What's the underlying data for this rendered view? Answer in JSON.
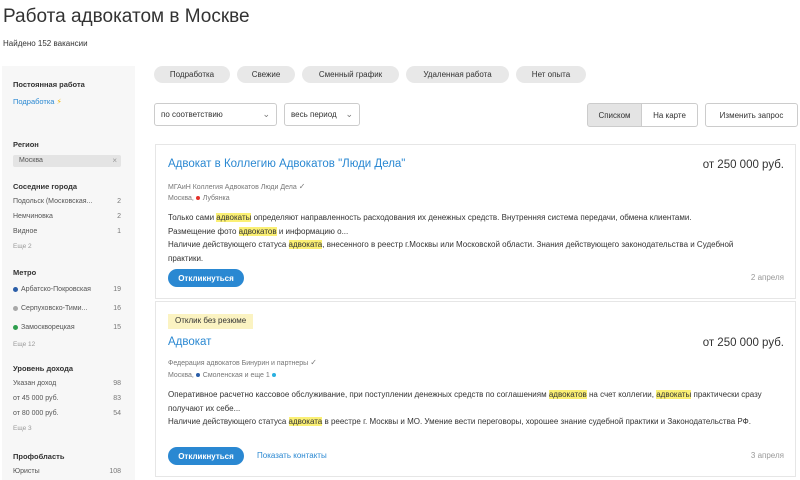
{
  "header": {
    "title": "Работа адвокатом в Москве",
    "found": "Найдено 152 вакансии"
  },
  "sidebar": {
    "permanent": {
      "heading": "Постоянная работа",
      "link": "Подработка"
    },
    "region": {
      "heading": "Регион",
      "value": "Москва",
      "clear": "×"
    },
    "nearby": {
      "heading": "Соседние города",
      "items": [
        {
          "label": "Подольск (Московская...",
          "count": "2"
        },
        {
          "label": "Немчиновка",
          "count": "2"
        },
        {
          "label": "Видное",
          "count": "1"
        }
      ],
      "more": "Еще 2"
    },
    "metro": {
      "heading": "Метро",
      "items": [
        {
          "label": "Арбатско-Покровская",
          "count": "19",
          "color": "#2b5ea8"
        },
        {
          "label": "Серпуховско-Тими...",
          "count": "16",
          "color": "#a8a8a8"
        },
        {
          "label": "Замоскворецкая",
          "count": "15",
          "color": "#2e9e4d"
        }
      ],
      "more": "Еще 12"
    },
    "income": {
      "heading": "Уровень дохода",
      "items": [
        {
          "label": "Указан доход",
          "count": "98"
        },
        {
          "label": "от 45 000 руб.",
          "count": "83"
        },
        {
          "label": "от 80 000 руб.",
          "count": "54"
        }
      ],
      "more": "Еще 3"
    },
    "profarea": {
      "heading": "Профобласть",
      "items": [
        {
          "label": "Юристы",
          "count": "108"
        }
      ]
    }
  },
  "filters": {
    "pills": [
      "Подработка",
      "Свежие",
      "Сменный график",
      "Удаленная работа",
      "Нет опыта"
    ]
  },
  "controls": {
    "sort": "по соответствию",
    "period": "весь период",
    "view_list": "Списком",
    "view_map": "На карте",
    "change_query": "Изменить запрос"
  },
  "vacancies": [
    {
      "title": "Адвокат в Коллегию Адвокатов \"Люди Дела\"",
      "salary": "от 250 000 руб.",
      "company": "МГАиН Коллегия Адвокатов Люди Дела",
      "location_city": "Москва,",
      "location_metro": "Лубянка",
      "metro_color": "#e4312b",
      "desc": [
        [
          "Только сами ",
          "адвокаты",
          " определяют направленность расходования их денежных средств. Внутренняя система передачи, обмена клиентами."
        ],
        [
          "Размещение фото ",
          "адвокатов",
          " и информацию о..."
        ],
        [
          "Наличие действующего статуса ",
          "адвоката",
          ", внесенного в реестр г.Москвы или Московской области. Знания действующего законодательства и Судебной практики."
        ]
      ],
      "respond": "Откликнуться",
      "date": "2 апреля"
    },
    {
      "badge": "Отклик без резюме",
      "title": "Адвокат",
      "salary": "от 250 000 руб.",
      "company": "Федерация адвокатов Бинурин и партнеры",
      "location_city": "Москва,",
      "location_metro": "Смоленская и еще 1",
      "metro_color": "#2b5ea8",
      "desc": [
        [
          "Оперативное расчетно кассовое обслуживание, при поступлении денежных средств по соглашениям ",
          "адвокатов",
          " на счет коллегии, ",
          "адвокаты",
          " практически сразу получают их себе..."
        ],
        [
          "Наличие действующего статуса ",
          "адвоката",
          " в реестре г. Москвы и МО. Умение вести переговоры, хорошее знание судебной практики и Законодательства РФ."
        ]
      ],
      "respond": "Откликнуться",
      "contacts": "Показать контакты",
      "date": "3 апреля"
    }
  ],
  "colors": {
    "link": "#2a88d2",
    "highlight": "#fbf074",
    "badge": "#fbf3c2"
  },
  "icons": {
    "check": "check-icon",
    "bolt": "bolt-icon",
    "chevron": "chevron-down-icon"
  }
}
